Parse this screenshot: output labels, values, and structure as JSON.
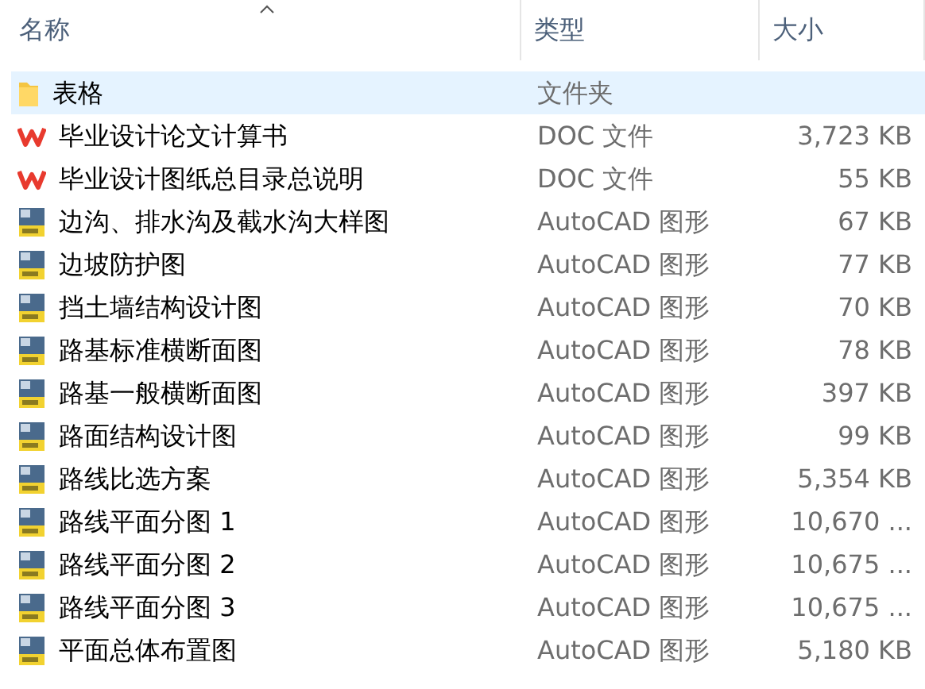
{
  "columns": [
    {
      "label": "名称",
      "sorted": true
    },
    {
      "label": "类型",
      "sorted": false
    },
    {
      "label": "大小",
      "sorted": false
    }
  ],
  "rows": [
    {
      "kind": "folder",
      "name": "表格",
      "type": "文件夹",
      "size": "",
      "selected": true
    },
    {
      "kind": "doc",
      "name": "毕业设计论文计算书",
      "type": "DOC 文件",
      "size": "3,723 KB",
      "selected": false
    },
    {
      "kind": "doc",
      "name": "毕业设计图纸总目录总说明",
      "type": "DOC 文件",
      "size": "55 KB",
      "selected": false
    },
    {
      "kind": "dwg",
      "name": "边沟、排水沟及截水沟大样图",
      "type": "AutoCAD 图形",
      "size": "67 KB",
      "selected": false
    },
    {
      "kind": "dwg",
      "name": "边坡防护图",
      "type": "AutoCAD 图形",
      "size": "77 KB",
      "selected": false
    },
    {
      "kind": "dwg",
      "name": "挡土墙结构设计图",
      "type": "AutoCAD 图形",
      "size": "70 KB",
      "selected": false
    },
    {
      "kind": "dwg",
      "name": "路基标准横断面图",
      "type": "AutoCAD 图形",
      "size": "78 KB",
      "selected": false
    },
    {
      "kind": "dwg",
      "name": "路基一般横断面图",
      "type": "AutoCAD 图形",
      "size": "397 KB",
      "selected": false
    },
    {
      "kind": "dwg",
      "name": "路面结构设计图",
      "type": "AutoCAD 图形",
      "size": "99 KB",
      "selected": false
    },
    {
      "kind": "dwg",
      "name": "路线比选方案",
      "type": "AutoCAD 图形",
      "size": "5,354 KB",
      "selected": false
    },
    {
      "kind": "dwg",
      "name": "路线平面分图 1",
      "type": "AutoCAD 图形",
      "size": "10,670 ...",
      "selected": false
    },
    {
      "kind": "dwg",
      "name": "路线平面分图 2",
      "type": "AutoCAD 图形",
      "size": "10,675 ...",
      "selected": false
    },
    {
      "kind": "dwg",
      "name": "路线平面分图 3",
      "type": "AutoCAD 图形",
      "size": "10,675 ...",
      "selected": false
    },
    {
      "kind": "dwg",
      "name": "平面总体布置图",
      "type": "AutoCAD 图形",
      "size": "5,180 KB",
      "selected": false
    }
  ]
}
